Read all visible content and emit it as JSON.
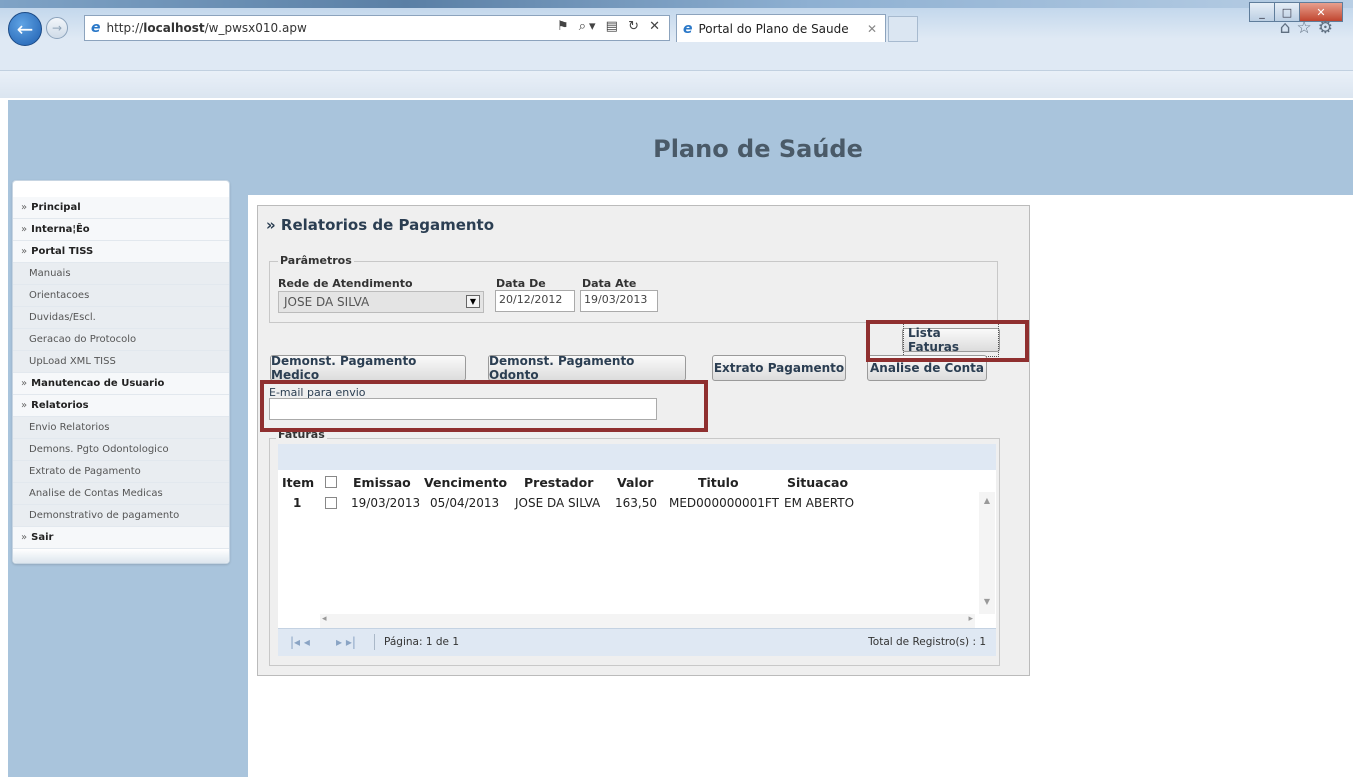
{
  "browser": {
    "url": "http://localhost/w_pwsx010.apw",
    "url_host": "localhost",
    "url_prefix": "http://",
    "url_path": "/w_pwsx010.apw",
    "tab_title": "Portal do Plano de Saude"
  },
  "site": {
    "title": "Plano de Saúde"
  },
  "menu": {
    "items": [
      {
        "label": "Principal",
        "type": "head"
      },
      {
        "label": "Interna¦Êo",
        "type": "head"
      },
      {
        "label": "Portal TISS",
        "type": "head"
      },
      {
        "label": "Manuais",
        "type": "sub"
      },
      {
        "label": "Orientacoes",
        "type": "sub"
      },
      {
        "label": "Duvidas/Escl.",
        "type": "sub"
      },
      {
        "label": "Geracao do Protocolo",
        "type": "sub"
      },
      {
        "label": "UpLoad XML TISS",
        "type": "sub"
      },
      {
        "label": "Manutencao de Usuario",
        "type": "head"
      },
      {
        "label": "Relatorios",
        "type": "head"
      },
      {
        "label": "Envio Relatorios",
        "type": "sub"
      },
      {
        "label": "Demons. Pgto Odontologico",
        "type": "sub"
      },
      {
        "label": "Extrato de Pagamento",
        "type": "sub"
      },
      {
        "label": "Analise de Contas Medicas",
        "type": "sub"
      },
      {
        "label": "Demonstrativo de pagamento",
        "type": "sub"
      },
      {
        "label": "Sair",
        "type": "head"
      }
    ]
  },
  "panel": {
    "title": "» Relatorios de Pagamento",
    "params_legend": "Parâmetros",
    "rede_label": "Rede de Atendimento",
    "rede_value": "JOSE DA SILVA",
    "data_de_label": "Data De",
    "data_de_value": "20/12/2012",
    "data_ate_label": "Data Ate",
    "data_ate_value": "19/03/2013",
    "btn_lista_faturas": "Lista Faturas",
    "btn_medico": "Demonst. Pagamento Medico",
    "btn_odonto": "Demonst. Pagamento Odonto",
    "btn_extrato": "Extrato Pagamento",
    "btn_analise": "Analise de Conta",
    "email_label": "E-mail para envio",
    "email_value": "",
    "faturas_legend": "Faturas"
  },
  "grid": {
    "columns": [
      "Item",
      "Emissao",
      "Vencimento",
      "Prestador",
      "Valor",
      "Titulo",
      "Situacao"
    ],
    "rows": [
      {
        "item": "1",
        "emissao": "19/03/2013",
        "vencimento": "05/04/2013",
        "prestador": "JOSE DA SILVA",
        "valor": "163,50",
        "titulo": "MED000000001FT",
        "situacao": "EM ABERTO"
      }
    ],
    "page_text": "Página: 1 de 1",
    "total_text": "Total de Registro(s) : 1"
  },
  "colors": {
    "header_bg": "#a9c4dc",
    "highlight": "#8f2f2f"
  }
}
